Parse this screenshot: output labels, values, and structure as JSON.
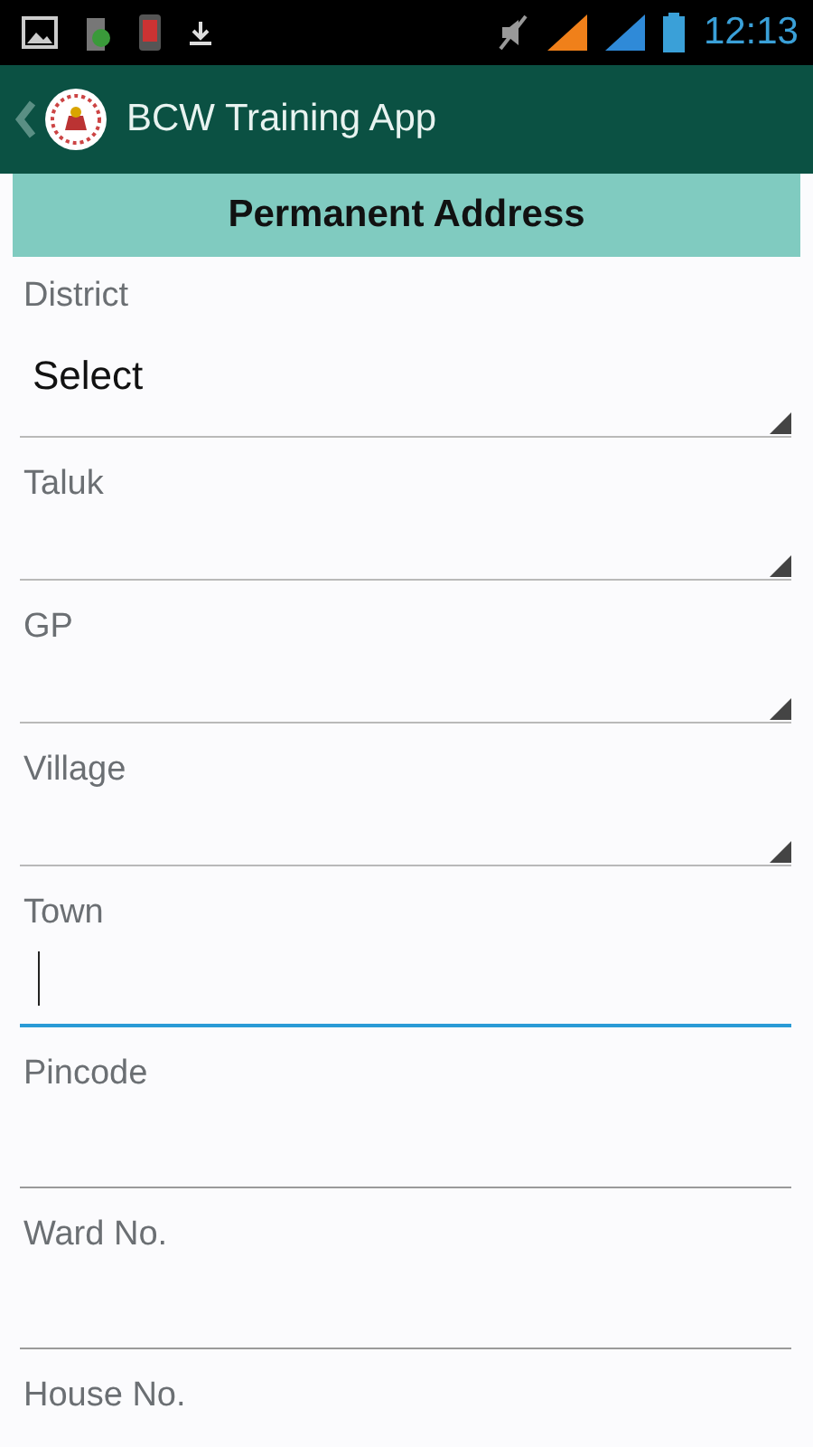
{
  "status_bar": {
    "time": "12:13"
  },
  "app_bar": {
    "title": "BCW Training App"
  },
  "section": {
    "title": "Permanent Address"
  },
  "fields": [
    {
      "kind": "select",
      "label": "District",
      "value": "Select",
      "focused": false
    },
    {
      "kind": "select",
      "label": "Taluk",
      "focused": false
    },
    {
      "kind": "select",
      "label": "GP",
      "focused": false
    },
    {
      "kind": "select",
      "label": "Village",
      "focused": false
    },
    {
      "kind": "text",
      "label": "Town",
      "focused": true
    },
    {
      "kind": "text",
      "label": "Pincode",
      "focused": false
    },
    {
      "kind": "text",
      "label": "Ward No.",
      "focused": false
    },
    {
      "kind": "text",
      "label": "House No."
    }
  ]
}
